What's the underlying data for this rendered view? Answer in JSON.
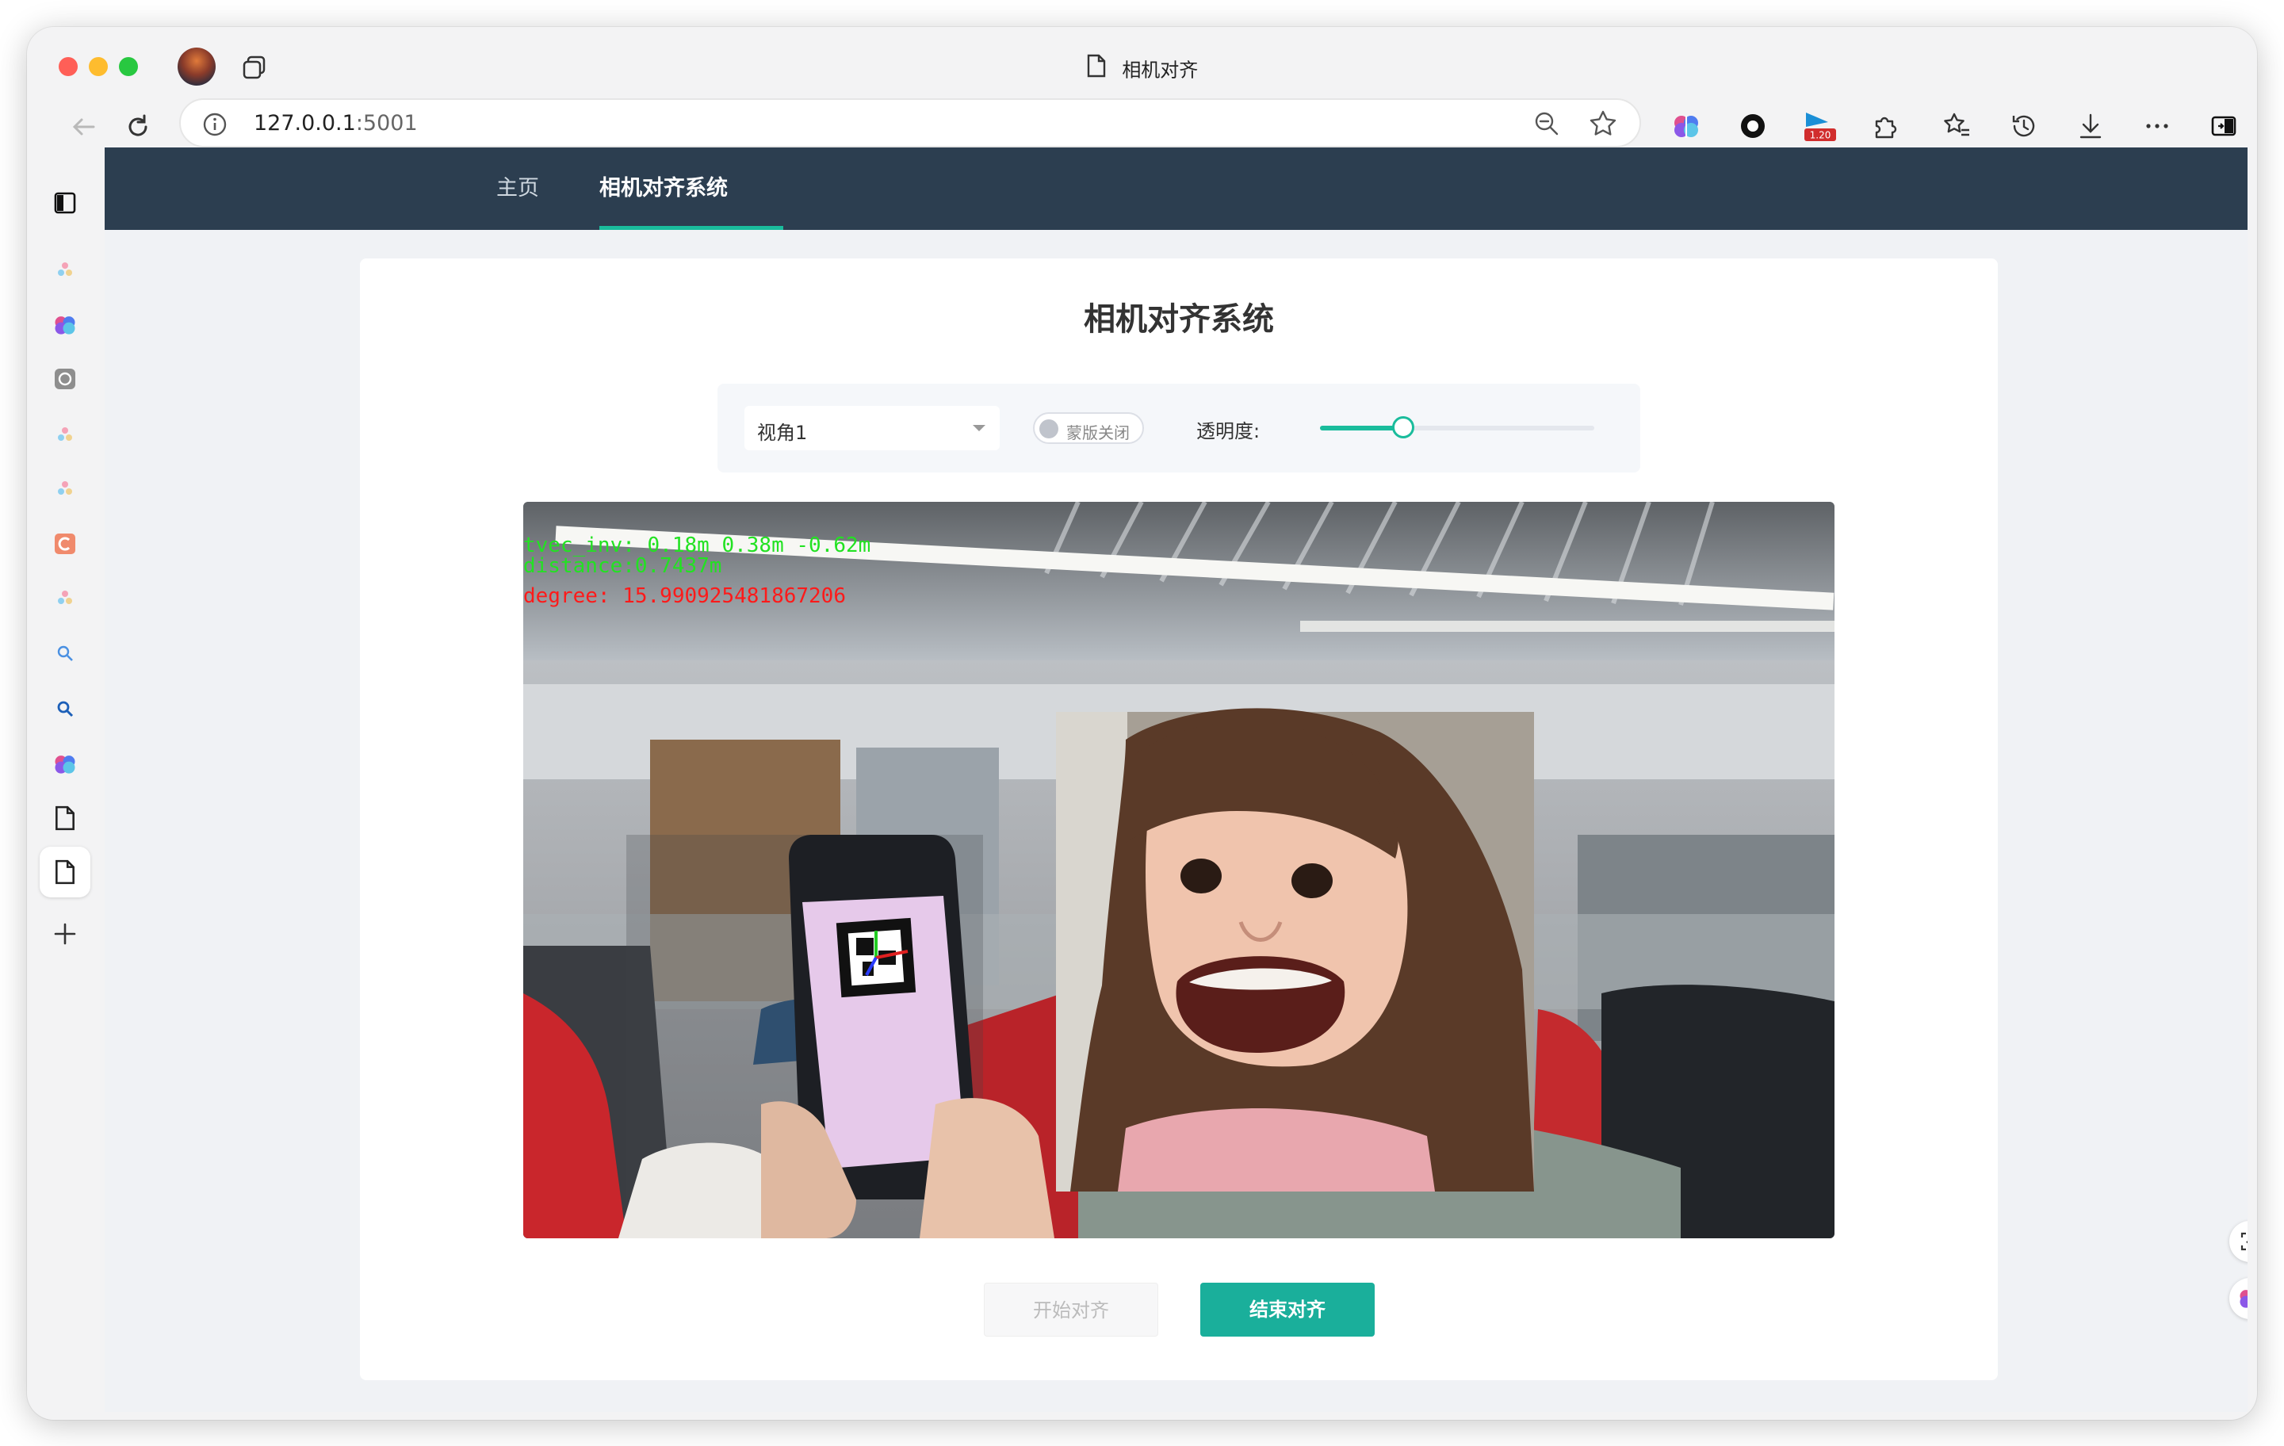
{
  "browser": {
    "tab_title": "相机对齐",
    "address": {
      "host": "127.0.0.1",
      "port": ":5001"
    },
    "extensions": {
      "badge_text": "1.20"
    }
  },
  "app": {
    "nav": [
      {
        "label": "主页",
        "active": false
      },
      {
        "label": "相机对齐系统",
        "active": true
      }
    ],
    "title": "相机对齐系统",
    "controls": {
      "view_select_value": "视角1",
      "mask_switch_label": "蒙版关闭",
      "mask_enabled": false,
      "opacity_label": "透明度:",
      "opacity_value": 0.3
    },
    "video_overlay": {
      "line1": "tvec_inv: 0.18m 0.38m -0.62m",
      "line2": "distance:0.7437m",
      "line3": "degree: 15.990925481867206"
    },
    "buttons": {
      "start_label": "开始对齐",
      "start_disabled": true,
      "end_label": "结束对齐"
    }
  },
  "colors": {
    "nav_bg": "#2c3e50",
    "accent": "#1abc9c",
    "end_button": "#1aaf9b"
  }
}
